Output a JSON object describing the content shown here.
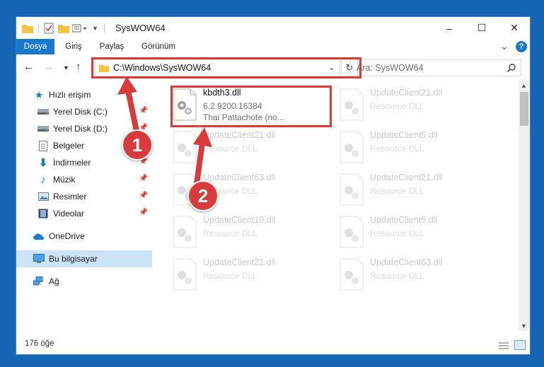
{
  "window": {
    "title": "SysWOW64",
    "minimize_glyph": "–",
    "maximize_glyph": "☐",
    "close_glyph": "✕"
  },
  "ribbon": {
    "tabs": [
      "Dosya",
      "Giriş",
      "Paylaş",
      "Görünüm"
    ],
    "collapse_glyph": "⌄",
    "help_glyph": "?"
  },
  "address": {
    "path": "C:\\Windows\\SysWOW64",
    "search_placeholder": "Ara: SysWOW64"
  },
  "sidebar": {
    "quick_access": "Hızlı erişim",
    "items": [
      {
        "label": "Yerel Disk (C:)",
        "icon": "drive-icon",
        "pinned": true
      },
      {
        "label": "Yerel Disk (D:)",
        "icon": "drive-icon",
        "pinned": true
      },
      {
        "label": "Belgeler",
        "icon": "documents-icon",
        "pinned": true
      },
      {
        "label": "İndirmeler",
        "icon": "download-icon",
        "pinned": true
      },
      {
        "label": "Müzik",
        "icon": "music-icon",
        "pinned": true
      },
      {
        "label": "Resimler",
        "icon": "pictures-icon",
        "pinned": true
      },
      {
        "label": "Videolar",
        "icon": "videos-icon",
        "pinned": true
      }
    ],
    "onedrive": "OneDrive",
    "this_pc": "Bu bilgisayar",
    "network": "Ağ"
  },
  "files": {
    "main": {
      "name": "kbdth3.dll",
      "version": "6.2.9200.16384",
      "description": "Thai Pattachote (no..."
    },
    "background": [
      {
        "name": "UpdateClient21.dll",
        "type": "Resource DLL"
      },
      {
        "name": "UpdateClient21.dll",
        "type": "Resource DLL"
      },
      {
        "name": "UpdateClient5.dll",
        "type": "Resource DLL"
      },
      {
        "name": "UpdateClient63.dll",
        "type": "Resource DLL"
      },
      {
        "name": "UpdateClient21.dll",
        "type": "Resource DLL"
      },
      {
        "name": "UpdateClient19.dll",
        "type": "Resource DLL"
      },
      {
        "name": "UpdateClient5.dll",
        "type": "Resource DLL"
      },
      {
        "name": "UpdateClient21.dll",
        "type": "Resource DLL"
      },
      {
        "name": "UpdateClient63.dll",
        "type": "Resource DLL"
      }
    ]
  },
  "status": {
    "count": "176 öğe"
  },
  "callouts": {
    "one": "1",
    "two": "2"
  },
  "colors": {
    "accent": "#1979ca",
    "highlight": "#d83b3b",
    "selected": "#cce4f7"
  }
}
